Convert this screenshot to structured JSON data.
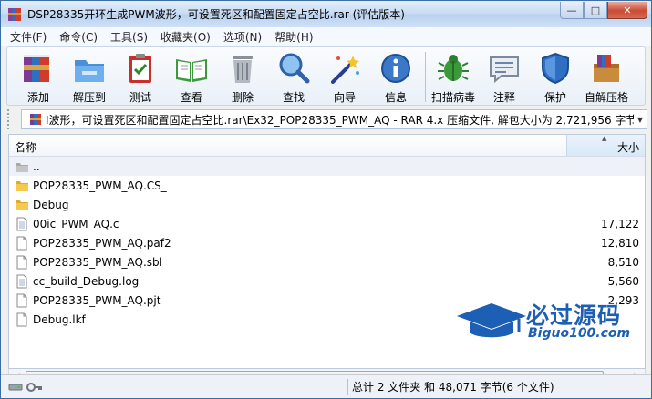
{
  "window": {
    "title": "DSP28335开环生成PWM波形，可设置死区和配置固定占空比.rar (评估版本)",
    "controls": {
      "minimize": "—",
      "maximize": "□",
      "close": "✕"
    }
  },
  "menu": [
    "文件(F)",
    "命令(C)",
    "工具(S)",
    "收藏夹(O)",
    "选项(N)",
    "帮助(H)"
  ],
  "toolbar": [
    {
      "label": "添加",
      "icon": "books-add-icon"
    },
    {
      "label": "解压到",
      "icon": "folder-extract-icon"
    },
    {
      "label": "测试",
      "icon": "clipboard-check-icon"
    },
    {
      "label": "查看",
      "icon": "open-book-icon"
    },
    {
      "label": "删除",
      "icon": "trash-icon"
    },
    {
      "label": "查找",
      "icon": "magnifier-icon"
    },
    {
      "label": "向导",
      "icon": "magic-wand-icon"
    },
    {
      "label": "信息",
      "icon": "info-icon"
    },
    {
      "label": "扫描病毒",
      "icon": "bug-icon"
    },
    {
      "label": "注释",
      "icon": "comment-icon"
    },
    {
      "label": "保护",
      "icon": "shield-icon"
    },
    {
      "label": "自解压格",
      "icon": "sfx-box-icon"
    }
  ],
  "address": {
    "path": "I波形，可设置死区和配置固定占空比.rar\\Ex32_POP28335_PWM_AQ - RAR 4.x 压缩文件, 解包大小为 2,721,956 字节"
  },
  "list": {
    "columns": {
      "name": "名称",
      "size": "大小"
    },
    "rows": [
      {
        "name": "..",
        "size": "",
        "type": "up"
      },
      {
        "name": "POP28335_PWM_AQ.CS_",
        "size": "",
        "type": "folder"
      },
      {
        "name": "Debug",
        "size": "",
        "type": "folder"
      },
      {
        "name": "00ic_PWM_AQ.c",
        "size": "17,122",
        "type": "file"
      },
      {
        "name": "POP28335_PWM_AQ.paf2",
        "size": "12,810",
        "type": "file"
      },
      {
        "name": "POP28335_PWM_AQ.sbl",
        "size": "8,510",
        "type": "file"
      },
      {
        "name": "cc_build_Debug.log",
        "size": "5,560",
        "type": "file"
      },
      {
        "name": "POP28335_PWM_AQ.pjt",
        "size": "2,293",
        "type": "file"
      },
      {
        "name": "Debug.lkf",
        "size": "",
        "type": "file"
      }
    ]
  },
  "status": {
    "summary": "总计 2 文件夹 和 48,071 字节(6 个文件)"
  },
  "watermark": {
    "title": "必过源码",
    "url": "Biguo100.com"
  },
  "colors": {
    "folder": "#f2c14e",
    "accent": "#1c5fb4"
  }
}
